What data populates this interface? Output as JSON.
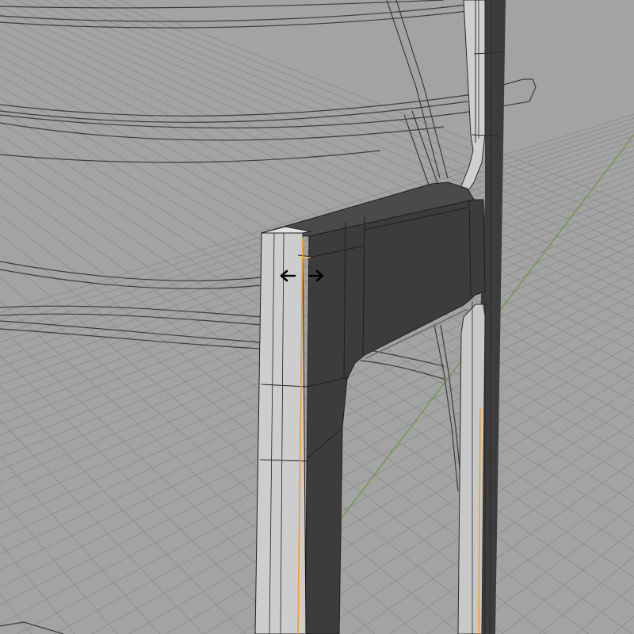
{
  "viewport": {
    "mode": "edit-mode",
    "tool": "edge-slide",
    "selection": "edge-loop"
  },
  "colors": {
    "background": "#a3a3a3",
    "grid_line": "#8f8f8f",
    "axis_y": "#6f9a48",
    "wireframe": "#3c3c3c",
    "face_light": "#c9c9c9",
    "face_dark": "#3c3c3c",
    "selected_edge": "#f0a030",
    "cursor": "#000000"
  },
  "icons": {
    "cursor": "horizontal-double-arrow-icon"
  }
}
